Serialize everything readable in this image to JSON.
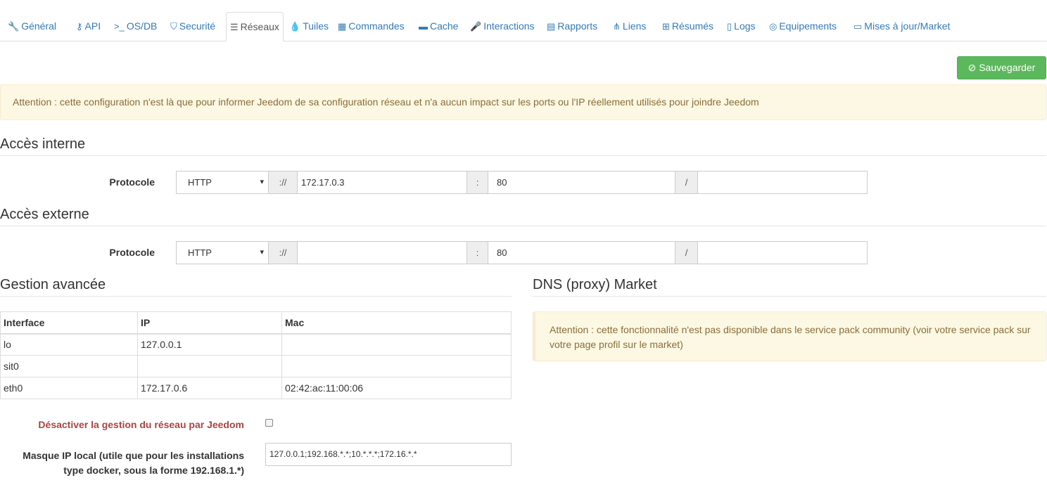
{
  "tabs": [
    {
      "label": "Général",
      "icon": "wrench-icon",
      "glyph": "🔧"
    },
    {
      "label": "API",
      "icon": "key-icon",
      "glyph": "⚷"
    },
    {
      "label": "OS/DB",
      "icon": "terminal-icon",
      "glyph": ">_"
    },
    {
      "label": "Securité",
      "icon": "shield-icon",
      "glyph": "⛉"
    },
    {
      "label": "Réseaux",
      "icon": "rss-icon",
      "glyph": "☰",
      "active": true
    },
    {
      "label": "Tuiles",
      "icon": "tint-icon",
      "glyph": "💧"
    },
    {
      "label": "Commandes",
      "icon": "table-icon",
      "glyph": "▦"
    },
    {
      "label": "Cache",
      "icon": "hdd-icon",
      "glyph": "▬"
    },
    {
      "label": "Interactions",
      "icon": "microphone-icon",
      "glyph": "🎤"
    },
    {
      "label": "Rapports",
      "icon": "list-alt-icon",
      "glyph": "▤"
    },
    {
      "label": "Liens",
      "icon": "sitemap-icon",
      "glyph": "⋔"
    },
    {
      "label": "Résumés",
      "icon": "grid-icon",
      "glyph": "⊞"
    },
    {
      "label": "Logs",
      "icon": "file-icon",
      "glyph": "▯"
    },
    {
      "label": "Equipements",
      "icon": "life-ring-icon",
      "glyph": "◎"
    },
    {
      "label": "Mises à jour/Market",
      "icon": "credit-card-icon",
      "glyph": "▭"
    }
  ],
  "save_label": "Sauvegarder",
  "alert_main": "Attention : cette configuration n'est là que pour informer Jeedom de sa configuration réseau et n'a aucun impact sur les ports ou l'IP réellement utilisés pour joindre Jeedom",
  "internal": {
    "title": "Accès interne",
    "label": "Protocole",
    "protocol": "HTTP",
    "sep1": "://",
    "ip": "172.17.0.3",
    "sep2": ":",
    "port": "80",
    "sep3": "/",
    "path": ""
  },
  "external": {
    "title": "Accès externe",
    "label": "Protocole",
    "protocol": "HTTP",
    "sep1": "://",
    "ip": "",
    "sep2": ":",
    "port": "80",
    "sep3": "/",
    "path": ""
  },
  "advanced": {
    "title": "Gestion avancée",
    "columns": [
      "Interface",
      "IP",
      "Mac"
    ],
    "rows": [
      [
        "lo",
        "127.0.0.1",
        ""
      ],
      [
        "sit0",
        "",
        ""
      ],
      [
        "eth0",
        "172.17.0.6",
        "02:42:ac:11:00:06"
      ]
    ],
    "disable_label": "Désactiver la gestion du réseau par Jeedom",
    "disable_checked": false,
    "mask_label": "Masque IP local (utile que pour les installations type docker, sous la forme 192.168.1.*)",
    "mask_value": "127.0.0.1;192.168.*.*;10.*.*.*;172.16.*.*"
  },
  "dns": {
    "title": "DNS (proxy) Market",
    "alert": "Attention : cette fonctionnalité n'est pas disponible dans le service pack community (voir votre service pack sur votre page profil sur le market)"
  }
}
